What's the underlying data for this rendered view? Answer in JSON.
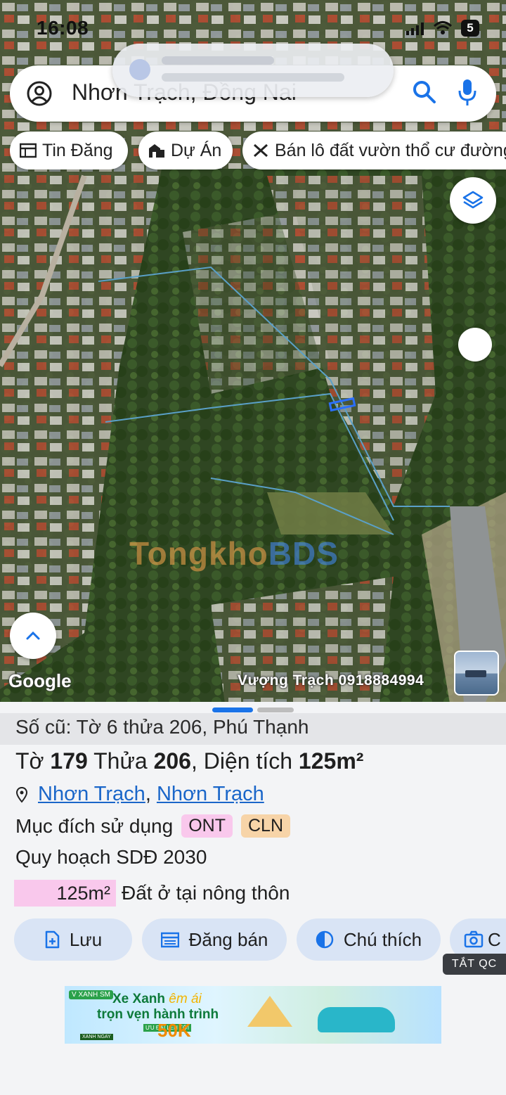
{
  "status_bar": {
    "time": "16:08",
    "battery": "5"
  },
  "search": {
    "query": "Nhơn Trạch, Đồng Nai"
  },
  "chips": [
    {
      "label": "Tin Đăng",
      "icon": "calendar-grid-icon"
    },
    {
      "label": "Dự Án",
      "icon": "building-icon"
    },
    {
      "label": "Bán lô đất vườn thổ cư đường",
      "icon": "tools-icon"
    }
  ],
  "map": {
    "attribution": "Google",
    "contact": "Vượng Trạch 0918884994",
    "watermark_left": "Tongkho",
    "watermark_right": "BDS"
  },
  "parcel": {
    "old_number": "Số cũ: Tờ 6 thửa 206, Phú Thạnh",
    "title_to": "Tờ",
    "sheet_no": "179",
    "title_thua": "Thửa",
    "parcel_no": "206",
    "title_area_prefix": ", Diện tích",
    "area": "125m²",
    "location_1": "Nhơn Trạch",
    "location_sep": ",",
    "location_2": "Nhơn Trạch",
    "purpose_label": "Mục đích sử dụng",
    "purpose_tags": [
      {
        "code": "ONT",
        "bg": "#f9c8ec"
      },
      {
        "code": "CLN",
        "bg": "#f7d4a8"
      }
    ],
    "plan": "Quy hoạch SDĐ 2030",
    "plan_area": "125m²",
    "plan_area_label": "Đất ở tại nông thôn",
    "plan_color": "#f9c8ec"
  },
  "actions": [
    {
      "label": "Lưu",
      "icon": "add-file-icon"
    },
    {
      "label": "Đăng bán",
      "icon": "calendar-list-icon"
    },
    {
      "label": "Chú thích",
      "icon": "contrast-icon"
    },
    {
      "label": "C",
      "icon": "camera-icon"
    }
  ],
  "ad": {
    "close_label": "TẮT QC",
    "brand": "V XANH SM",
    "headline_1": "Xe Xanh",
    "headline_1b": "êm ái",
    "headline_2": "trọn vẹn hành trình",
    "promo_small": "ƯU ĐÃI LÊN TỚI",
    "promo": "50K",
    "cta": "XANH NGAY"
  },
  "colors": {
    "accent": "#1a73e8",
    "chip_bg": "#ffffff",
    "action_bg": "#d9e4f5",
    "link": "#1a66c9"
  }
}
